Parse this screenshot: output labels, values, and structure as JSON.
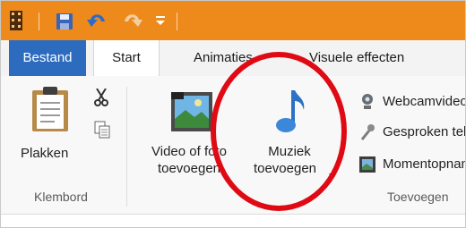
{
  "tabs": {
    "file": "Bestand",
    "start": "Start",
    "animations": "Animaties",
    "visual_effects": "Visuele effecten"
  },
  "clipboard": {
    "paste": "Plakken",
    "group": "Klembord"
  },
  "add": {
    "video_photo_line1": "Video of foto",
    "video_photo_line2": "toevoegen",
    "music_line1": "Muziek",
    "music_line2": "toevoegen",
    "webcam": "Webcamvideo",
    "narration": "Gesproken tekst",
    "snapshot": "Momentopname",
    "group": "Toevoegen"
  },
  "colors": {
    "titlebar": "#ee8a1c",
    "file_tab": "#2d6bbf",
    "annotation": "#e00a14"
  }
}
